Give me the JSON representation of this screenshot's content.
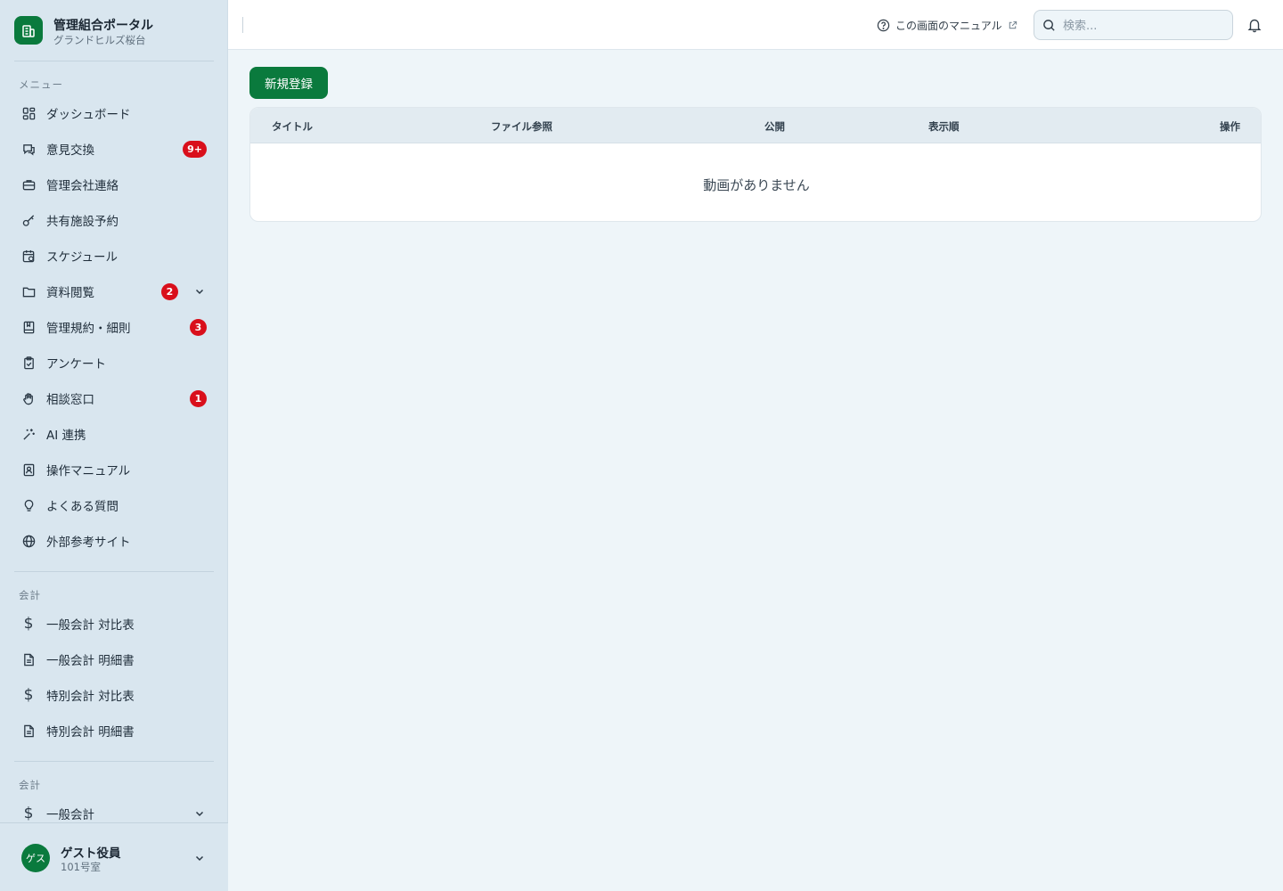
{
  "brand": {
    "title": "管理組合ポータル",
    "subtitle": "グランドヒルズ桜台"
  },
  "sidebar": {
    "menu_label": "メニュー",
    "items": [
      {
        "label": "ダッシュボード",
        "icon": "dashboard-grid-icon"
      },
      {
        "label": "意見交換",
        "icon": "chat-icon",
        "badge": "9+"
      },
      {
        "label": "管理会社連絡",
        "icon": "briefcase-icon"
      },
      {
        "label": "共有施設予約",
        "icon": "key-icon"
      },
      {
        "label": "スケジュール",
        "icon": "calendar-clock-icon"
      },
      {
        "label": "資料閲覧",
        "icon": "folder-icon",
        "badge": "2",
        "expandable": true
      },
      {
        "label": "管理規約・細則",
        "icon": "book-icon",
        "badge": "3"
      },
      {
        "label": "アンケート",
        "icon": "clipboard-check-icon"
      },
      {
        "label": "相談窓口",
        "icon": "hand-icon",
        "badge": "1"
      },
      {
        "label": "AI 連携",
        "icon": "sparkle-icon"
      },
      {
        "label": "操作マニュアル",
        "icon": "manual-book-icon"
      },
      {
        "label": "よくある質問",
        "icon": "lightbulb-icon"
      },
      {
        "label": "外部参考サイト",
        "icon": "globe-icon"
      }
    ],
    "accounting_label": "会計",
    "accounting_items": [
      {
        "label": "一般会計 対比表",
        "icon": "dollar-icon"
      },
      {
        "label": "一般会計 明細書",
        "icon": "document-icon"
      },
      {
        "label": "特別会計 対比表",
        "icon": "dollar-icon"
      },
      {
        "label": "特別会計 明細書",
        "icon": "document-icon"
      }
    ],
    "accounting2_label": "会計",
    "accounting2_items": [
      {
        "label": "一般会計",
        "icon": "dollar-icon",
        "expandable": true
      }
    ]
  },
  "user": {
    "avatar_text": "ゲス",
    "name": "ゲスト役員",
    "room": "101号室"
  },
  "header": {
    "manual_link": "この画面のマニュアル",
    "search_placeholder": "検索..."
  },
  "main": {
    "new_button": "新規登録",
    "columns": [
      "タイトル",
      "ファイル参照",
      "公開",
      "表示順",
      "操作"
    ],
    "empty_message": "動画がありません"
  },
  "colors": {
    "brand": "#0a7a3d",
    "badge": "#d90f1b",
    "sidebar_bg": "#d9e6ef"
  }
}
